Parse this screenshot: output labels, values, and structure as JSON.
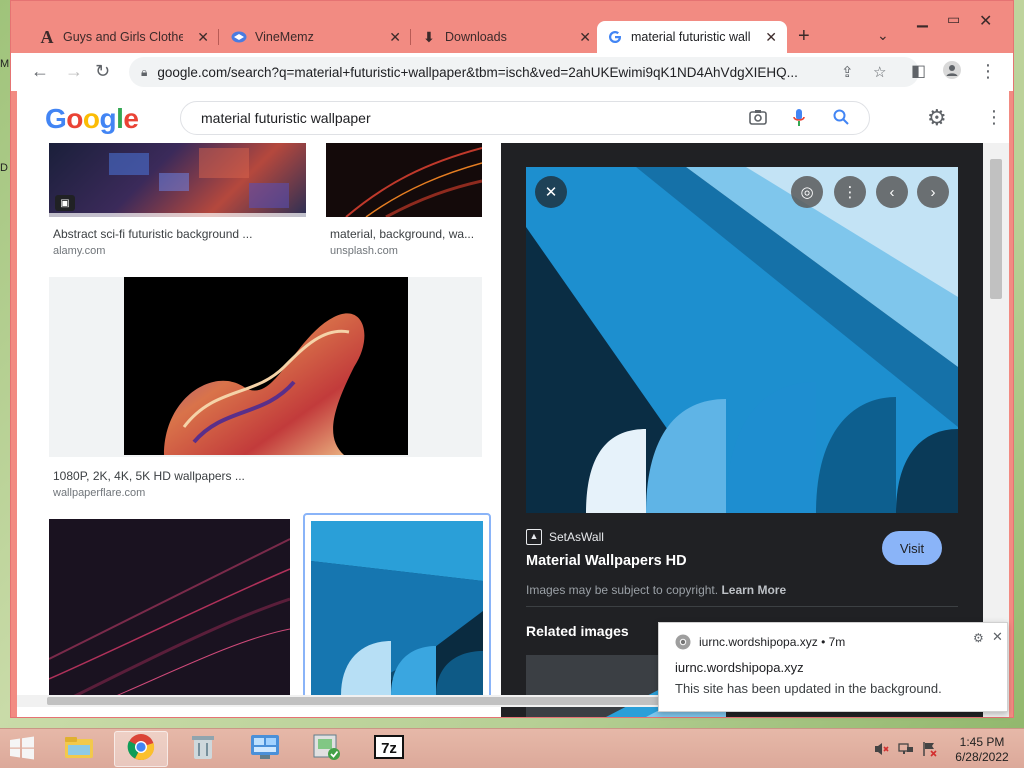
{
  "tabs": [
    {
      "title": "Guys and Girls Clothes",
      "icon": "text-a-icon"
    },
    {
      "title": "VineMemz",
      "icon": "vinememz-icon"
    },
    {
      "title": "Downloads",
      "icon": "download-icon"
    },
    {
      "title": "material futuristic wallp",
      "icon": "google-g-icon"
    }
  ],
  "address_bar": {
    "url": "google.com/search?q=material+futuristic+wallpaper&tbm=isch&ved=2ahUKEwimi9qK1ND4AhVdgXIEHQ..."
  },
  "google": {
    "logo": "Google",
    "query": "material futuristic wallpaper"
  },
  "results": [
    {
      "caption": "Abstract sci-fi futuristic background ...",
      "source": "alamy.com"
    },
    {
      "caption": "material, background, wa...",
      "source": "unsplash.com"
    },
    {
      "caption": "1080P, 2K, 4K, 5K HD wallpapers ...",
      "source": "wallpaperflare.com"
    }
  ],
  "preview": {
    "site": "SetAsWall",
    "title": "Material Wallpapers HD",
    "visit_label": "Visit",
    "copyright_text": "Images may be subject to copyright.",
    "learn_more": "Learn More",
    "related_heading": "Related images"
  },
  "notification": {
    "host": "iurnc.wordshipopa.xyz",
    "age": "7m",
    "title": "iurnc.wordshipopa.xyz",
    "message": "This site has been updated in the background."
  },
  "taskbar": {
    "apps": [
      "file-explorer-icon",
      "chrome-icon",
      "recycle-app-icon",
      "control-panel-icon",
      "verified-app-icon",
      "7zip-icon"
    ],
    "time": "1:45 PM",
    "date": "6/28/2022"
  },
  "colors": {
    "chrome_frame": "#f28b82",
    "preview_bg": "#202124",
    "visit_button": "#8ab4f8"
  }
}
